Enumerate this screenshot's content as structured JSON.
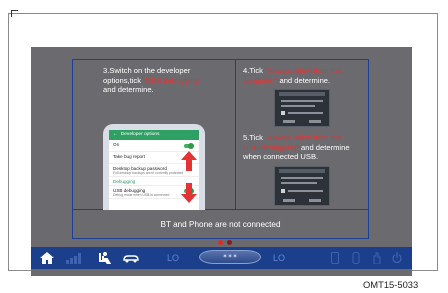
{
  "figure_code": "OMT15-5033",
  "instructions": {
    "step3": {
      "line1": "3.Switch on the developer",
      "line2_prefix": "options,tick ",
      "line2_red": "\"USB debugging\"",
      "line3": "and determine."
    },
    "step4": {
      "line1_prefix": "4.Tick ",
      "line1_red": "\"Always allow from this",
      "line2_red": "computer\"",
      "line2_suffix": " and determine."
    },
    "step5": {
      "line1_prefix": "5.Tick ",
      "line1_red": "\"Always allow from this",
      "line2_red": "USB debugging\"",
      "line2_suffix": " and determine",
      "line3": "when connected USB."
    }
  },
  "phone": {
    "header": "Developer options",
    "rows": [
      {
        "label": "On",
        "sub": "",
        "toggle": true
      },
      {
        "label": "Take bug report",
        "sub": "",
        "toggle": false
      },
      {
        "label": "Desktop backup password",
        "sub": "Full desktop backups aren't currently protected",
        "toggle": false
      },
      {
        "label": "Debugging",
        "sub": "",
        "toggle": false
      },
      {
        "label": "USB debugging",
        "sub": "Debug mode when USB is connected",
        "toggle": true
      }
    ]
  },
  "status_message": "BT and Phone are not connected",
  "page_dots": {
    "active_color": "#e02a2a",
    "inactive_color": "#8b1a1a"
  },
  "bottom_bar": {
    "left_level": "LO",
    "right_level": "LO",
    "center_icon": "fan-icon",
    "accent": "#1c3f8c",
    "icons": [
      "home-icon",
      "signal-bars-icon",
      "seat-person-icon",
      "car-airflow-icon",
      "phone-icon",
      "seat-heat-icon",
      "hand-icon",
      "power-icon"
    ]
  }
}
